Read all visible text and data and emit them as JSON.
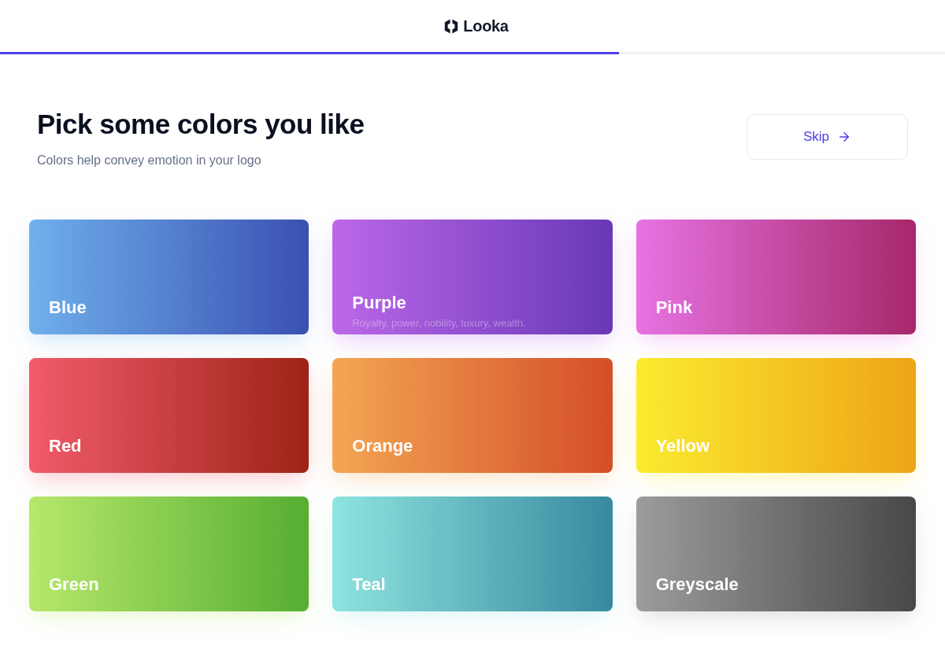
{
  "header": {
    "brand": "Looka"
  },
  "progress": {
    "level": 0.655
  },
  "page": {
    "title": "Pick some colors you like",
    "subtitle": "Colors help convey emotion in your logo",
    "skip_button": "Skip"
  },
  "cards": [
    {
      "label": "Blue",
      "stops": [
        {
          "color": "#6fb0ec"
        },
        {
          "color": "#3a50b2"
        }
      ]
    },
    {
      "label": "Purple",
      "stops": [
        {
          "color": "#bb68e8"
        },
        {
          "color": "#6838b6"
        }
      ],
      "description": "Royalty, power, nobility, luxury, wealth."
    },
    {
      "label": "Pink",
      "stops": [
        {
          "color": "#e673e2"
        },
        {
          "color": "#a6276a"
        }
      ]
    },
    {
      "label": "Red",
      "stops": [
        {
          "color": "#f15c6a"
        },
        {
          "color": "#9e2317"
        }
      ]
    },
    {
      "label": "Orange",
      "stops": [
        {
          "color": "#f3a654"
        },
        {
          "color": "#d44e28"
        }
      ]
    },
    {
      "label": "Yellow",
      "stops": [
        {
          "color": "#faeb30"
        },
        {
          "color": "#eea416"
        }
      ]
    },
    {
      "label": "Green",
      "stops": [
        {
          "color": "#b6e86c"
        },
        {
          "color": "#56ae31"
        }
      ]
    },
    {
      "label": "Teal",
      "stops": [
        {
          "color": "#8ee4df"
        },
        {
          "color": "#38899f"
        }
      ]
    },
    {
      "label": "Greyscale",
      "stops": [
        {
          "color": "#9c9c9c"
        },
        {
          "color": "#484848"
        }
      ]
    }
  ]
}
